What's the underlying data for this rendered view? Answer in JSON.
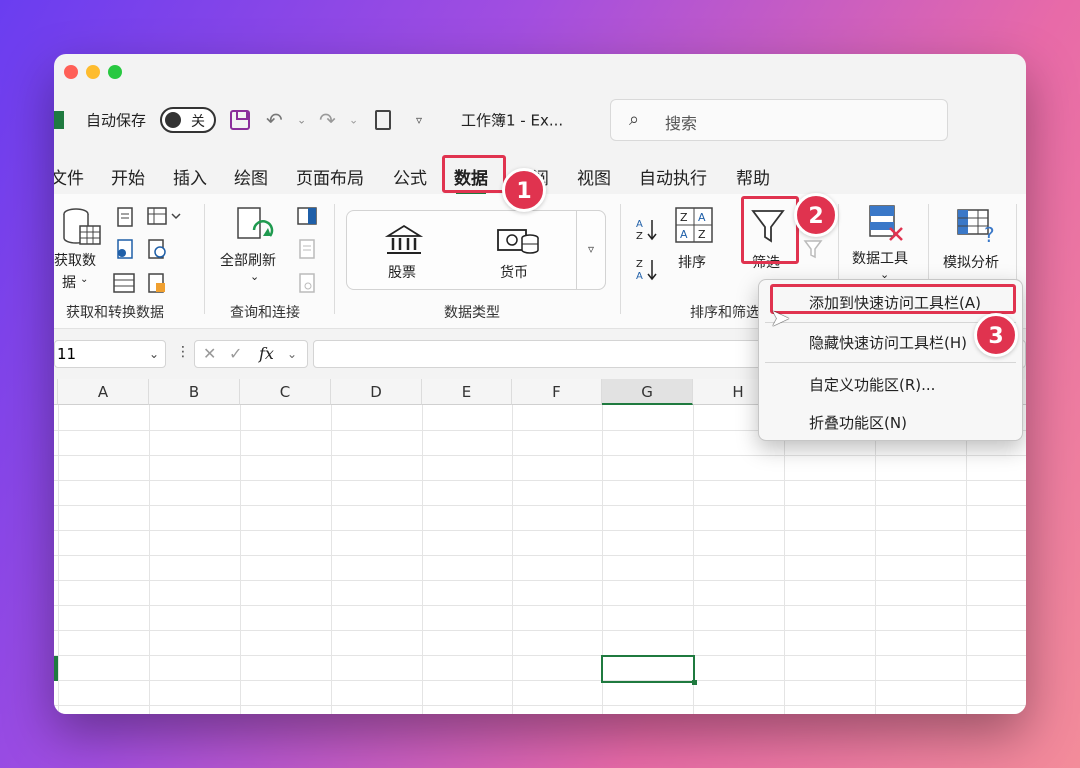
{
  "titlebar": {
    "autosave_label": "自动保存",
    "toggle_state": "关",
    "doc_title": "工作簿1  -  Ex...",
    "search_placeholder": "搜索"
  },
  "tabs": [
    "文件",
    "开始",
    "插入",
    "绘图",
    "页面布局",
    "公式",
    "数据",
    "审阅",
    "视图",
    "自动执行",
    "帮助"
  ],
  "active_tab": "数据",
  "ribbon": {
    "get_data_label_1": "获取数",
    "get_data_label_2": "据",
    "group_get_transform": "获取和转换数据",
    "refresh_all_label": "全部刷新",
    "group_query_connect": "查询和连接",
    "stocks_label": "股票",
    "currency_label": "货币",
    "group_data_types": "数据类型",
    "sort_label": "排序",
    "filter_label": "筛选",
    "group_sort_filter": "排序和筛选",
    "data_tools_label": "数据工具",
    "what_if_label": "模拟分析"
  },
  "formula_bar": {
    "name_box": "11",
    "fx": "fx"
  },
  "columns": [
    "A",
    "B",
    "C",
    "D",
    "E",
    "F",
    "G",
    "H"
  ],
  "selected_column": "G",
  "context_menu": {
    "items": [
      "添加到快速访问工具栏(A)",
      "隐藏快速访问工具栏(H)",
      "自定义功能区(R)...",
      "折叠功能区(N)"
    ]
  },
  "steps": [
    "1",
    "2",
    "3"
  ],
  "colors": {
    "accent": "#1f7a3f",
    "highlight": "#e0334f"
  }
}
